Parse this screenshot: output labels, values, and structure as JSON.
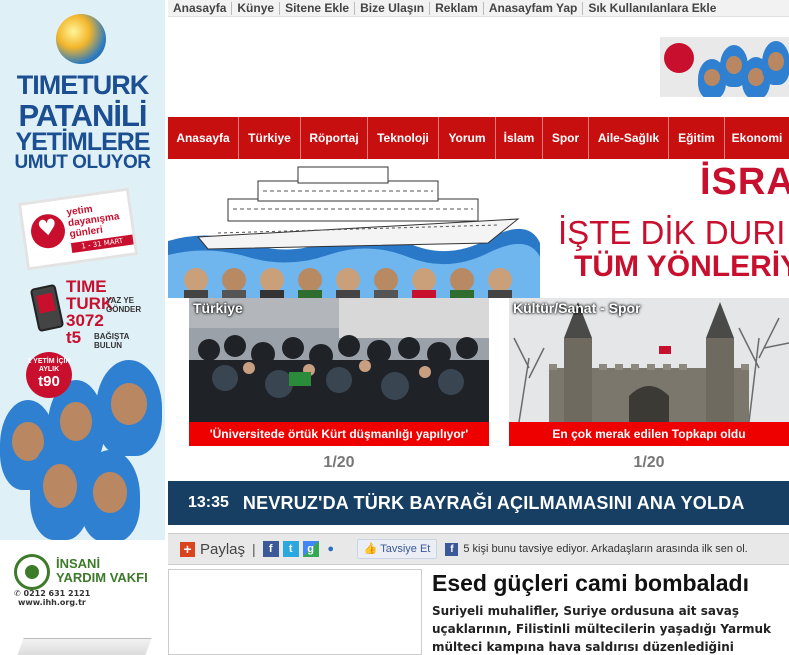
{
  "top_links": [
    "Anasayfa",
    "Künye",
    "Sitene Ekle",
    "Bize Ulaşın",
    "Reklam",
    "Anasayfam Yap",
    "Sık Kullanılanlara Ekle"
  ],
  "nav": [
    "Anasayfa",
    "Türkiye",
    "Röportaj",
    "Teknoloji",
    "Yorum",
    "İslam",
    "Spor",
    "Aile-Sağlık",
    "Eğitim",
    "Ekonomi"
  ],
  "left_ad": {
    "brand_line1": "TIMETURK",
    "brand_line2": "PATANİLİ",
    "brand_line3": "YETİMLERE",
    "brand_line4": "UMUT OLUYOR",
    "event_text": "yetim dayanışma günleri",
    "event_dates": "1 - 31 MART 2013",
    "sms_line1": "TIME",
    "sms_line2": "TURK",
    "sms_line3": "3072",
    "sms_side": "YAZ YE GÖNDER",
    "sms_price": "t5",
    "sms_side2": "BAĞIŞTA BULUN",
    "badge_top": "1 YETİM İÇİN AYLIK",
    "badge_price": "t90"
  },
  "ihh": {
    "name_line1": "İNSANİ",
    "name_line2": "YARDIM VAKFI",
    "phone": "0212 631 2121",
    "web": "www.ihh.org.tr"
  },
  "banner": {
    "line1": "İSRAİ",
    "line2": "İŞTE DİK DURI",
    "line3": "TÜM YÖNLERİYLE"
  },
  "slider_left": {
    "category": "Türkiye",
    "caption": "'Üniversitede örtük Kürt düşmanlığı yapılıyor'",
    "counter": "1/20"
  },
  "slider_right": {
    "category": "Kültür/Sanat - Spor",
    "caption": "En çok merak edilen Topkapı oldu",
    "counter": "1/20"
  },
  "breaking": {
    "time": "13:35",
    "headline": "NEVRUZ'DA TÜRK BAYRAĞI AÇILMAMASINI ANA YOLDA"
  },
  "share": {
    "label": "Paylaş",
    "separator": "|",
    "like_label": "Tavsiye Et",
    "fb_text": "5 kişi bunu tavsiye ediyor. Arkadaşların arasında ilk sen ol."
  },
  "article": {
    "title": "Esed güçleri cami bombaladı",
    "body": "Suriyeli muhalifler, Suriye ordusuna ait savaş uçaklarının, Filistinli mültecilerin yaşadığı Yarmuk mülteci kampına hava saldırısı düzenlediğini duyurdu"
  },
  "colors": {
    "nav_red": "#c80f10",
    "breaking_blue": "#173f63",
    "caption_red": "#ee0000"
  }
}
